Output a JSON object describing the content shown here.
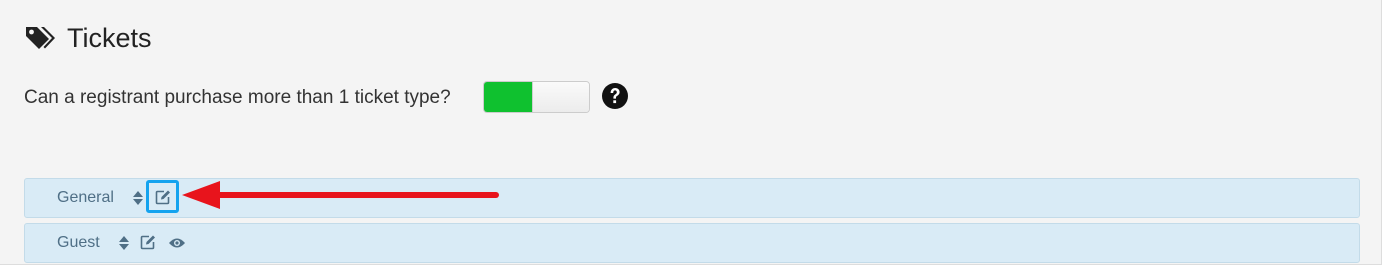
{
  "section": {
    "title": "Tickets",
    "icon": "tags-icon"
  },
  "setting": {
    "question": "Can a registrant purchase more than 1 ticket type?",
    "toggle_state": "on",
    "toggle_on_color": "#0fc12f",
    "help_icon": "question-circle-icon"
  },
  "tickets": [
    {
      "label": "General",
      "icons": [
        "sort-icon",
        "edit-icon"
      ]
    },
    {
      "label": "Guest",
      "icons": [
        "sort-icon",
        "edit-icon",
        "eye-icon"
      ]
    }
  ],
  "annotation": {
    "highlight_color": "#14a3ef",
    "arrow_color": "#e8141c"
  }
}
